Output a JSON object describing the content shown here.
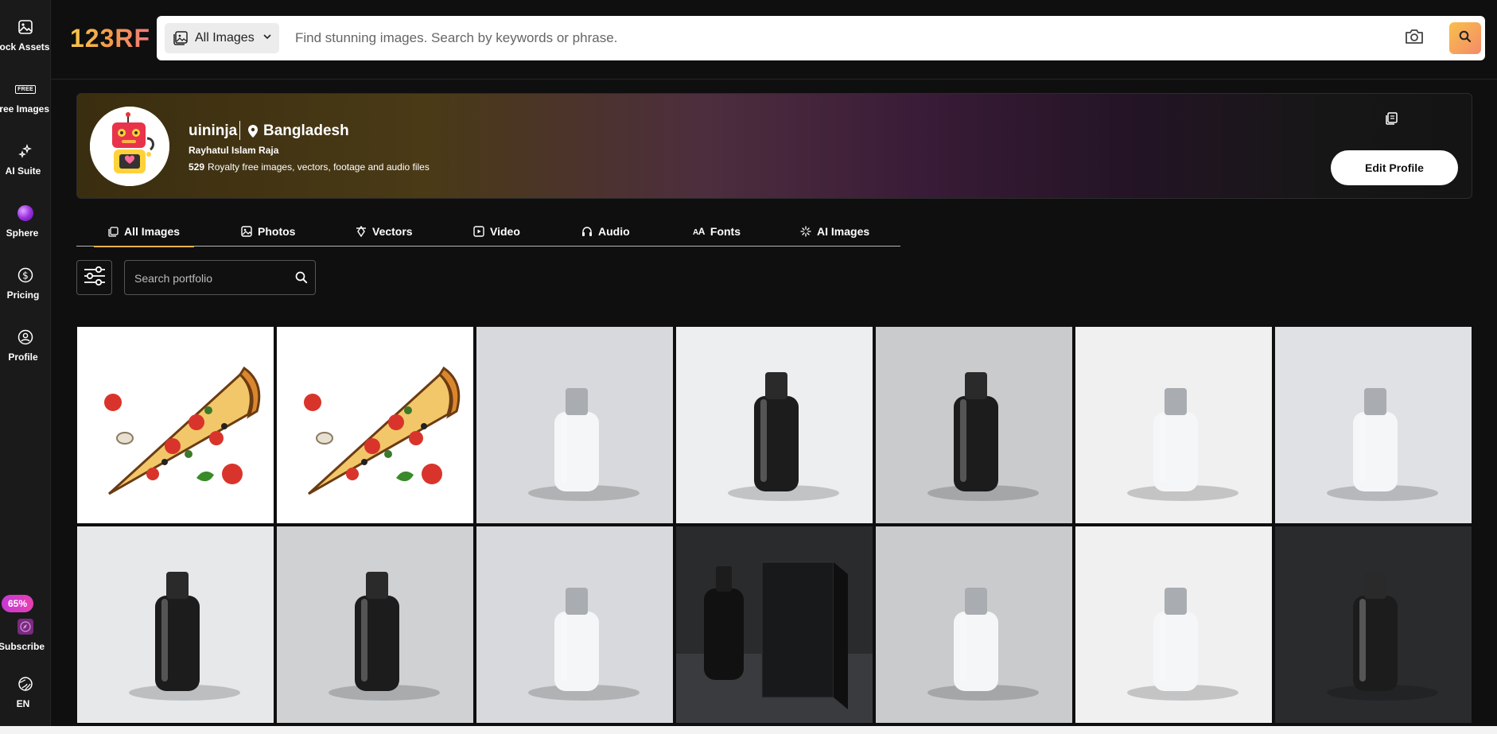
{
  "sidebar": {
    "items": [
      {
        "label": "Stock Assets",
        "icon": "image-icon"
      },
      {
        "label": "Free Images",
        "icon": "free-badge-icon",
        "badge": "FREE"
      },
      {
        "label": "AI Suite",
        "icon": "sparkle-icon"
      },
      {
        "label": "Sphere",
        "icon": "sphere-icon"
      },
      {
        "label": "Pricing",
        "icon": "dollar-circle-icon"
      },
      {
        "label": "Profile",
        "icon": "profile-circle-icon"
      }
    ],
    "discount": "65%",
    "subscribe": "Subscribe",
    "language": "EN"
  },
  "header": {
    "logo": "123RF",
    "type_select": "All Images",
    "search_placeholder": "Find stunning images. Search by keywords or phrase."
  },
  "profile": {
    "username": "uininja",
    "country": "Bangladesh",
    "full_name": "Rayhatul Islam Raja",
    "count": "529",
    "count_text": "Royalty free images, vectors, footage and audio files",
    "edit_label": "Edit Profile"
  },
  "tabs": [
    {
      "label": "All Images",
      "icon": "all-images-icon",
      "active": true
    },
    {
      "label": "Photos",
      "icon": "photo-icon",
      "active": false
    },
    {
      "label": "Vectors",
      "icon": "vector-pen-icon",
      "active": false
    },
    {
      "label": "Video",
      "icon": "video-icon",
      "active": false
    },
    {
      "label": "Audio",
      "icon": "headphones-icon",
      "active": false
    },
    {
      "label": "Fonts",
      "icon": "font-aa-icon",
      "active": false
    },
    {
      "label": "AI Images",
      "icon": "ai-sparkle-icon",
      "active": false
    }
  ],
  "portfolio_search_placeholder": "Search portfolio",
  "colors": {
    "accent": "#f3b24a",
    "background": "#0f0f0f",
    "sidebar": "#1a1a1a"
  },
  "grid": [
    {
      "kind": "pizza-illustration"
    },
    {
      "kind": "pizza-illustration"
    },
    {
      "kind": "white-bottle"
    },
    {
      "kind": "black-bottle"
    },
    {
      "kind": "black-bottle"
    },
    {
      "kind": "white-bottle"
    },
    {
      "kind": "white-bottle"
    },
    {
      "kind": "black-bottle"
    },
    {
      "kind": "black-bottle"
    },
    {
      "kind": "white-bottle"
    },
    {
      "kind": "black-bottle-with-box"
    },
    {
      "kind": "white-bottle"
    },
    {
      "kind": "white-bottle"
    },
    {
      "kind": "black-bottle"
    }
  ]
}
